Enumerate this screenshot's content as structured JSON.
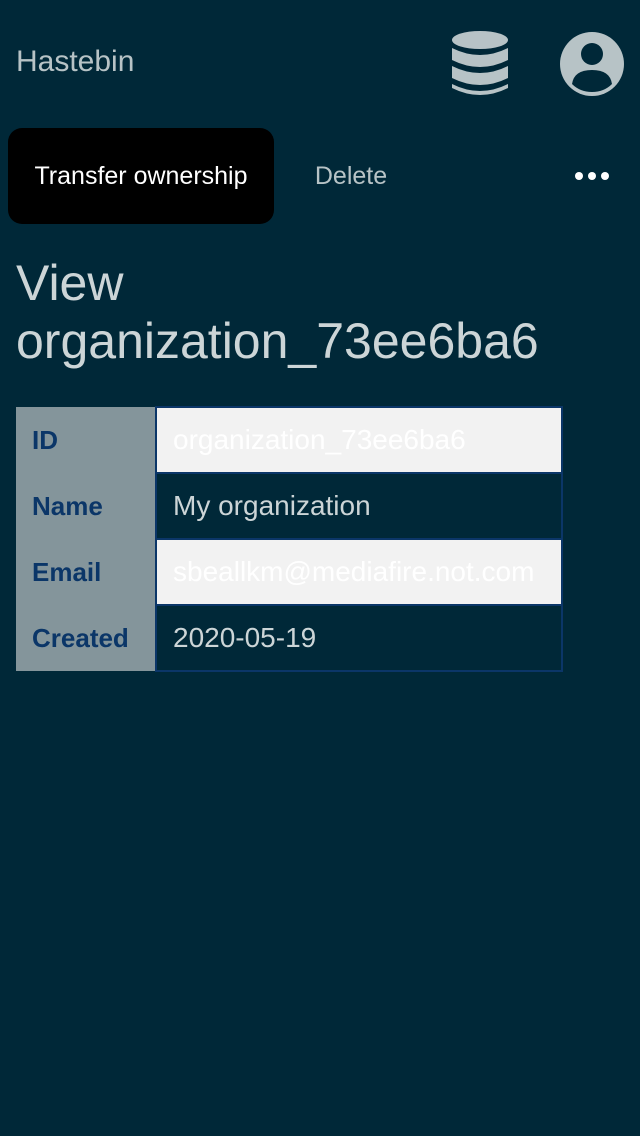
{
  "header": {
    "app_name": "Hastebin",
    "icons": [
      "database-icon",
      "account-icon"
    ]
  },
  "toolbar": {
    "transfer_label": "Transfer ownership",
    "delete_label": "Delete",
    "more_icon": "more-horizontal-icon"
  },
  "page": {
    "title": "View organization_73ee6ba6"
  },
  "details": {
    "rows": [
      {
        "label": "ID",
        "value": "organization_73ee6ba6"
      },
      {
        "label": "Name",
        "value": "My organization"
      },
      {
        "label": "Email",
        "value": "sbeallkm@mediafire.not.com"
      },
      {
        "label": "Created",
        "value": "2020-05-19"
      }
    ]
  },
  "colors": {
    "background": "#002838",
    "header_text": "#b7c3c6",
    "label_cell": "#84959b",
    "label_text": "#0b3668",
    "light_cell": "#f2f2f2",
    "primary_button": "#000000"
  }
}
